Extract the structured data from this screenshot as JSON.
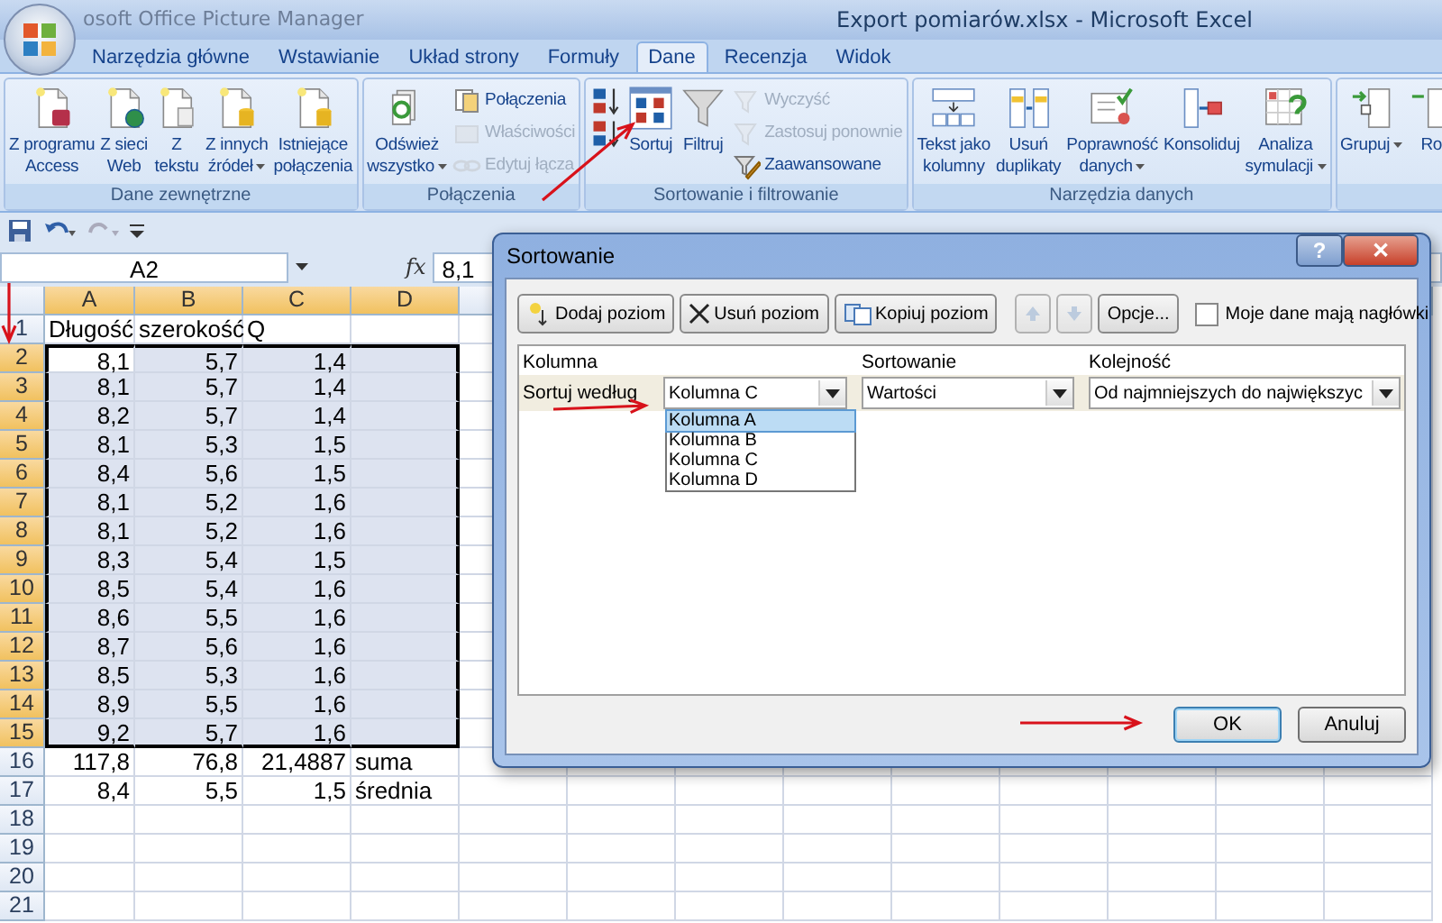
{
  "window": {
    "title": "Export pomiarów.xlsx - Microsoft Excel",
    "background_window_title": "osoft Office Picture Manager"
  },
  "ribbon_tabs": [
    {
      "label": "Narzędzia główne",
      "selected": false
    },
    {
      "label": "Wstawianie",
      "selected": false
    },
    {
      "label": "Układ strony",
      "selected": false
    },
    {
      "label": "Formuły",
      "selected": false
    },
    {
      "label": "Dane",
      "selected": true
    },
    {
      "label": "Recenzja",
      "selected": false
    },
    {
      "label": "Widok",
      "selected": false
    }
  ],
  "ribbon_groups": [
    {
      "label": "Dane zewnętrzne",
      "items": [
        {
          "kind": "large",
          "label": "Z programu\nAccess",
          "menu": false
        },
        {
          "kind": "large",
          "label": "Z sieci\nWeb",
          "menu": false
        },
        {
          "kind": "large",
          "label": "Z\ntekstu",
          "menu": false
        },
        {
          "kind": "large",
          "label": "Z innych\nźródeł",
          "menu": true
        },
        {
          "kind": "large",
          "label": "Istniejące\npołączenia",
          "menu": false
        }
      ]
    },
    {
      "label": "Połączenia",
      "items": [
        {
          "kind": "large",
          "label": "Odśwież\nwszystko",
          "menu": true
        },
        {
          "kind": "stack",
          "items": [
            {
              "label": "Połączenia",
              "disabled": false
            },
            {
              "label": "Właściwości",
              "disabled": true
            },
            {
              "label": "Edytuj łącza",
              "disabled": true
            }
          ]
        }
      ]
    },
    {
      "label": "Sortowanie i filtrowanie",
      "items": [
        {
          "kind": "stack",
          "items": [
            {
              "disabled": false
            },
            {
              "disabled": false
            }
          ]
        },
        {
          "kind": "large",
          "label": "Sortuj",
          "menu": false
        },
        {
          "kind": "large",
          "label": "Filtruj",
          "menu": false
        },
        {
          "kind": "stack",
          "items": [
            {
              "label": "Wyczyść",
              "disabled": true
            },
            {
              "label": "Zastosuj ponownie",
              "disabled": true
            },
            {
              "label": "Zaawansowane",
              "disabled": false
            }
          ]
        }
      ]
    },
    {
      "label": "Narzędzia danych",
      "items": [
        {
          "kind": "large",
          "label": "Tekst jako\nkolumny",
          "menu": false
        },
        {
          "kind": "large",
          "label": "Usuń\nduplikaty",
          "menu": false
        },
        {
          "kind": "large",
          "label": "Poprawność\ndanych",
          "menu": true
        },
        {
          "kind": "large",
          "label": "Konsoliduj",
          "menu": false
        },
        {
          "kind": "large",
          "label": "Analiza\nsymulacji",
          "menu": true
        }
      ]
    },
    {
      "items": [
        {
          "kind": "large",
          "label": "Grupuj",
          "menu": true
        },
        {
          "kind": "large",
          "label": "Ro",
          "menu": false
        }
      ]
    }
  ],
  "formula_bar": {
    "name_box": "A2",
    "function_label": "fx",
    "formula": "8,1"
  },
  "sheet": {
    "columns": [
      {
        "label": "A",
        "selected": true
      },
      {
        "label": "B",
        "selected": true
      },
      {
        "label": "C",
        "selected": true
      },
      {
        "label": "D",
        "selected": true
      }
    ],
    "rows": [
      {
        "number": "1",
        "kind": "text",
        "selected": false,
        "cells": [
          "Długość",
          "szerokość",
          "Q",
          null
        ]
      },
      {
        "number": "2",
        "kind": "number",
        "selected": true,
        "cells": [
          {
            "value": "8,1",
            "active": true
          },
          "5,7",
          "1,4",
          null
        ]
      },
      {
        "number": "3",
        "kind": "number",
        "selected": true,
        "cells": [
          "8,1",
          "5,7",
          "1,4",
          null
        ]
      },
      {
        "number": "4",
        "kind": "number",
        "selected": true,
        "cells": [
          "8,2",
          "5,7",
          "1,4",
          null
        ]
      },
      {
        "number": "5",
        "kind": "number",
        "selected": true,
        "cells": [
          "8,1",
          "5,3",
          "1,5",
          null
        ]
      },
      {
        "number": "6",
        "kind": "number",
        "selected": true,
        "cells": [
          "8,4",
          "5,6",
          "1,5",
          null
        ]
      },
      {
        "number": "7",
        "kind": "number",
        "selected": true,
        "cells": [
          "8,1",
          "5,2",
          "1,6",
          null
        ]
      },
      {
        "number": "8",
        "kind": "number",
        "selected": true,
        "cells": [
          "8,1",
          "5,2",
          "1,6",
          null
        ]
      },
      {
        "number": "9",
        "kind": "number",
        "selected": true,
        "cells": [
          "8,3",
          "5,4",
          "1,5",
          null
        ]
      },
      {
        "number": "10",
        "kind": "number",
        "selected": true,
        "cells": [
          "8,5",
          "5,4",
          "1,6",
          null
        ]
      },
      {
        "number": "11",
        "kind": "number",
        "selected": true,
        "cells": [
          "8,6",
          "5,5",
          "1,6",
          null
        ]
      },
      {
        "number": "12",
        "kind": "number",
        "selected": true,
        "cells": [
          "8,7",
          "5,6",
          "1,6",
          null
        ]
      },
      {
        "number": "13",
        "kind": "number",
        "selected": true,
        "cells": [
          "8,5",
          "5,3",
          "1,6",
          null
        ]
      },
      {
        "number": "14",
        "kind": "number",
        "selected": true,
        "cells": [
          "8,9",
          "5,5",
          "1,6",
          null
        ]
      },
      {
        "number": "15",
        "kind": "number",
        "selected": true,
        "cells": [
          "9,2",
          "5,7",
          "1,6",
          null
        ]
      },
      {
        "number": "16",
        "kind": "number",
        "selected": false,
        "cells": [
          "117,8",
          "76,8",
          "21,4887",
          "suma"
        ]
      },
      {
        "number": "17",
        "kind": "number",
        "selected": false,
        "cells": [
          "8,4",
          "5,5",
          "1,5",
          "średnia"
        ]
      },
      {
        "number": "18",
        "kind": "number",
        "selected": false,
        "cells": [
          null,
          null,
          null,
          null
        ]
      },
      {
        "number": "19",
        "kind": "number",
        "selected": false,
        "cells": [
          null,
          null,
          null,
          null
        ]
      },
      {
        "number": "20",
        "kind": "number",
        "selected": false,
        "cells": [
          null,
          null,
          null,
          null
        ]
      },
      {
        "number": "21",
        "kind": "number",
        "selected": false,
        "cells": [
          null,
          null,
          null,
          null
        ]
      }
    ]
  },
  "sort_dialog": {
    "title": "Sortowanie",
    "title_buttons": [
      {
        "kind": "help",
        "label": "?"
      },
      {
        "kind": "close",
        "label": "✕"
      }
    ],
    "toolbar": [
      {
        "kind": "add",
        "label": "Dodaj poziom",
        "disabled": false
      },
      {
        "kind": "delete",
        "label": "Usuń poziom",
        "disabled": false
      },
      {
        "kind": "copy",
        "label": "Kopiuj poziom",
        "disabled": false
      },
      {
        "kind": "up",
        "disabled": true
      },
      {
        "kind": "down",
        "disabled": true
      },
      {
        "kind": "plain",
        "label": "Opcje...",
        "disabled": false
      }
    ],
    "headers_checkbox": {
      "label": "Moje dane mają nagłówki",
      "checked": false
    },
    "columns": [
      "Kolumna",
      "Sortowanie",
      "Kolejność"
    ],
    "level": {
      "label": "Sortuj według",
      "column": "Kolumna C",
      "sort_on": "Wartości",
      "order": "Od najmniejszych do największyc"
    },
    "column_options": [
      {
        "label": "Kolumna A",
        "selected": true
      },
      {
        "label": "Kolumna B",
        "selected": false
      },
      {
        "label": "Kolumna C",
        "selected": false
      },
      {
        "label": "Kolumna D",
        "selected": false
      }
    ],
    "buttons": [
      {
        "label": "OK",
        "default": true
      },
      {
        "label": "Anuluj",
        "default": false
      }
    ]
  }
}
